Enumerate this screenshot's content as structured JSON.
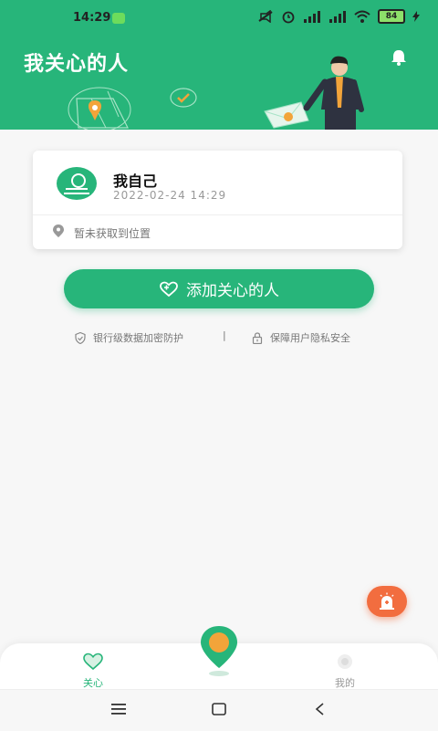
{
  "status_bar": {
    "time": "14:29",
    "battery": "84"
  },
  "header": {
    "title": "我关心的人",
    "bell_icon": "bell-icon"
  },
  "profile_card": {
    "name": "我自己",
    "timestamp": "2022-02-24 14:29",
    "location_status": "暂未获取到位置"
  },
  "actions": {
    "add_button_label": "添加关心的人"
  },
  "security": {
    "left_text": "银行级数据加密防护",
    "separator": "|",
    "right_text": "保障用户隐私安全"
  },
  "bottom_nav": {
    "items": [
      {
        "label": "关心",
        "icon": "heart-icon",
        "active": true
      },
      {
        "label": "",
        "icon": "map-pin-icon",
        "active": false
      },
      {
        "label": "我的",
        "icon": "eye-icon",
        "active": false
      }
    ]
  },
  "colors": {
    "brand_green": "#27b57a",
    "sos_orange": "#f26d3f"
  }
}
